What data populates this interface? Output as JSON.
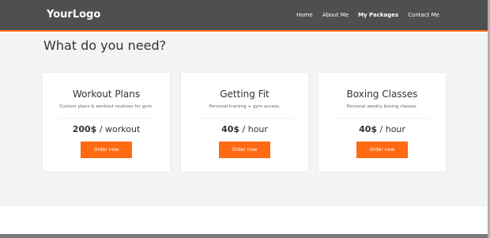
{
  "navbar": {
    "logo": "YourLogo",
    "links": [
      "Home",
      "About Me",
      "My Packages",
      "Contact Me"
    ],
    "active_index": 2
  },
  "section": {
    "title": "What do you need?"
  },
  "cards": [
    {
      "title": "Workout Plans",
      "description": "Custom plans & workout routines for gym.",
      "price": "200$",
      "unit": " / workout",
      "button_label": "Order now"
    },
    {
      "title": "Getting Fit",
      "description": "Personal training + gym access.",
      "price": "40$",
      "unit": " / hour",
      "button_label": "Order now"
    },
    {
      "title": "Boxing Classes",
      "description": "Personal weekly boxing classes.",
      "price": "40$",
      "unit": " / hour",
      "button_label": "Order now"
    }
  ],
  "colors": {
    "navbar_bg": "#4f4f4f",
    "accent": "#ff6a13",
    "section_bg": "#f4f4f4"
  }
}
